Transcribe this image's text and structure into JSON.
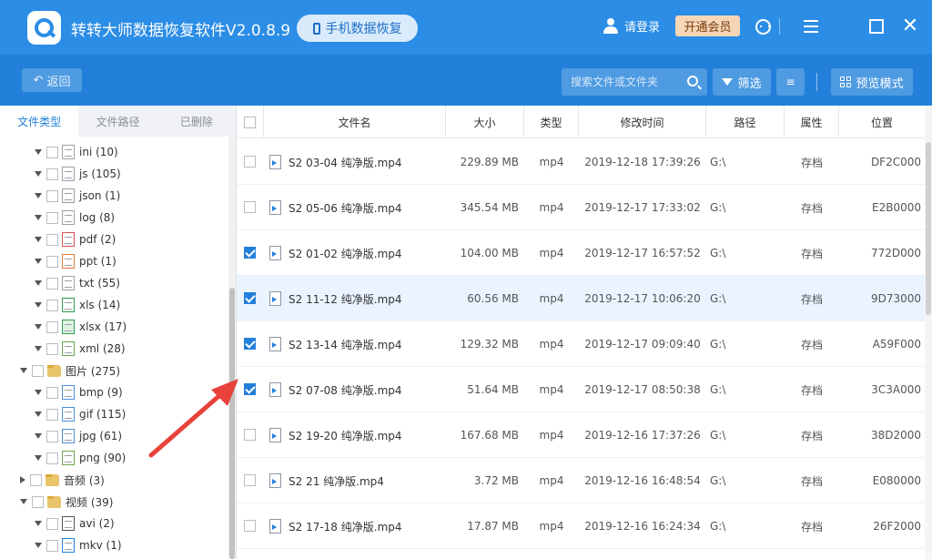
{
  "app": {
    "title": "转转大师数据恢复软件V2.0.8.9",
    "phone_recovery_label": "手机数据恢复",
    "login_label": "请登录",
    "vip_label": "开通会员"
  },
  "toolbar": {
    "back_label": "返回",
    "search_placeholder": "搜索文件或文件夹",
    "filter_label": "筛选",
    "preview_label": "预览模式"
  },
  "left_tabs": [
    {
      "label": "文件类型"
    },
    {
      "label": "文件路径"
    },
    {
      "label": "已删除"
    }
  ],
  "tree": [
    {
      "label": "ini (10)"
    },
    {
      "label": "js (105)"
    },
    {
      "label": "json (1)"
    },
    {
      "label": "log (8)"
    },
    {
      "label": "pdf (2)"
    },
    {
      "label": "ppt (1)"
    },
    {
      "label": "txt (55)"
    },
    {
      "label": "xls (14)"
    },
    {
      "label": "xlsx (17)"
    },
    {
      "label": "xml (28)"
    },
    {
      "label": "图片 (275)"
    },
    {
      "label": "bmp (9)"
    },
    {
      "label": "gif (115)"
    },
    {
      "label": "jpg (61)"
    },
    {
      "label": "png (90)"
    },
    {
      "label": "音频 (3)"
    },
    {
      "label": "视频 (39)"
    },
    {
      "label": "avi (2)"
    },
    {
      "label": "mkv (1)"
    }
  ],
  "table": {
    "headers": [
      "文件名",
      "大小",
      "类型",
      "修改时间",
      "路径",
      "属性",
      "位置"
    ],
    "rows": [
      {
        "checked": false,
        "name": "S2 03-04 纯净版.mp4",
        "size": "229.89 MB",
        "type": "mp4",
        "mtime": "2019-12-18 17:39:26",
        "path": "G:\\",
        "attr": "存档",
        "pos": "DF2C000"
      },
      {
        "checked": false,
        "name": "S2 05-06 纯净版.mp4",
        "size": "345.54 MB",
        "type": "mp4",
        "mtime": "2019-12-17 17:33:02",
        "path": "G:\\",
        "attr": "存档",
        "pos": "E2B0000"
      },
      {
        "checked": true,
        "name": "S2 01-02 纯净版.mp4",
        "size": "104.00 MB",
        "type": "mp4",
        "mtime": "2019-12-17 16:57:52",
        "path": "G:\\",
        "attr": "存档",
        "pos": "772D000"
      },
      {
        "checked": true,
        "name": "S2 11-12 纯净版.mp4",
        "size": "60.56 MB",
        "type": "mp4",
        "mtime": "2019-12-17 10:06:20",
        "path": "G:\\",
        "attr": "存档",
        "pos": "9D73000"
      },
      {
        "checked": true,
        "name": "S2 13-14 纯净版.mp4",
        "size": "129.32 MB",
        "type": "mp4",
        "mtime": "2019-12-17 09:09:40",
        "path": "G:\\",
        "attr": "存档",
        "pos": "A59F000"
      },
      {
        "checked": true,
        "name": "S2 07-08 纯净版.mp4",
        "size": "51.64 MB",
        "type": "mp4",
        "mtime": "2019-12-17 08:50:38",
        "path": "G:\\",
        "attr": "存档",
        "pos": "3C3A000"
      },
      {
        "checked": false,
        "name": "S2 19-20 纯净版.mp4",
        "size": "167.68 MB",
        "type": "mp4",
        "mtime": "2019-12-16 17:37:26",
        "path": "G:\\",
        "attr": "存档",
        "pos": "38D2000"
      },
      {
        "checked": false,
        "name": "S2 21 纯净版.mp4",
        "size": "3.72 MB",
        "type": "mp4",
        "mtime": "2019-12-16 16:48:54",
        "path": "G:\\",
        "attr": "存档",
        "pos": "E080000"
      },
      {
        "checked": false,
        "name": "S2 17-18 纯净版.mp4",
        "size": "17.87 MB",
        "type": "mp4",
        "mtime": "2019-12-16 16:24:34",
        "path": "G:\\",
        "attr": "存档",
        "pos": "26F2000"
      }
    ]
  },
  "colors": {
    "titlebar": "#2b8de6",
    "toolbar": "#2380da",
    "accent": "#2380da",
    "vip_bg": "#f5d6b7",
    "annotation_arrow": "#e8423a"
  }
}
